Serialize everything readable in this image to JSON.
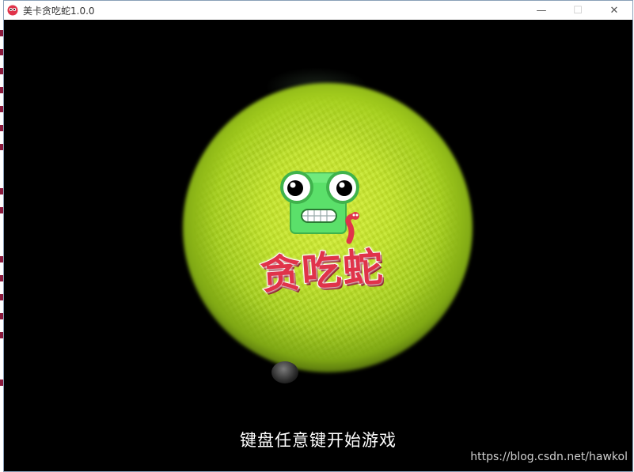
{
  "window": {
    "title": "美卡贪吃蛇1.0.0",
    "controls": {
      "minimize": "—",
      "maximize": "☐",
      "close": "✕"
    }
  },
  "game": {
    "logo_text": "贪吃蛇",
    "prompt": "键盘任意键开始游戏"
  },
  "watermark": "https://blog.csdn.net/hawkol",
  "colors": {
    "background": "#000000",
    "spotlight": "#c4e62a",
    "snake_green": "#5be06a",
    "logo_red": "#e0334a",
    "prompt_text": "#ffffff"
  }
}
